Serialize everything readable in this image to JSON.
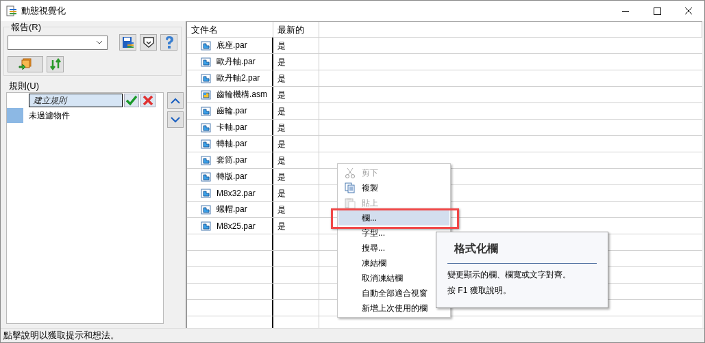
{
  "window": {
    "title": "動態視覺化"
  },
  "report": {
    "label": "報告(R)"
  },
  "rules": {
    "label": "規則(U)",
    "new_rule": {
      "placeholder": "建立規則"
    },
    "items": [
      {
        "label": "未過濾物件",
        "color": "#8cb8e4"
      }
    ]
  },
  "table": {
    "columns": [
      "文件名",
      "最新的"
    ],
    "rows": [
      {
        "kind": "part",
        "name": "底座.par",
        "latest": "是"
      },
      {
        "kind": "part",
        "name": "歐丹軸.par",
        "latest": "是"
      },
      {
        "kind": "part",
        "name": "歐丹軸2.par",
        "latest": "是"
      },
      {
        "kind": "assembly",
        "name": "齒輪機構.asm",
        "latest": "是"
      },
      {
        "kind": "part",
        "name": "齒輪.par",
        "latest": "是"
      },
      {
        "kind": "part",
        "name": "卡軸.par",
        "latest": "是"
      },
      {
        "kind": "part",
        "name": "轉軸.par",
        "latest": "是"
      },
      {
        "kind": "part",
        "name": "套筒.par",
        "latest": "是"
      },
      {
        "kind": "part",
        "name": "轉版.par",
        "latest": "是"
      },
      {
        "kind": "part",
        "name": "M8x32.par",
        "latest": "是"
      },
      {
        "kind": "part",
        "name": "螺帽.par",
        "latest": "是"
      },
      {
        "kind": "part",
        "name": "M8x25.par",
        "latest": "是"
      }
    ]
  },
  "context_menu": [
    {
      "label": "剪下",
      "kind": "cut",
      "disabled": true,
      "selected": false
    },
    {
      "label": "複製",
      "kind": "copy",
      "disabled": false,
      "selected": false
    },
    {
      "label": "貼上",
      "kind": "paste",
      "disabled": true,
      "selected": false
    },
    {
      "label": "欄...",
      "disabled": false,
      "selected": true,
      "outlined": true
    },
    {
      "label": "字型...",
      "disabled": false,
      "selected": false
    },
    {
      "label": "搜尋...",
      "disabled": false,
      "selected": false
    },
    {
      "label": "凍結欄",
      "disabled": false,
      "selected": false
    },
    {
      "label": "取消凍結欄",
      "disabled": false,
      "selected": false
    },
    {
      "label": "自動全部適合視窗",
      "disabled": false,
      "selected": false
    },
    {
      "label": "新增上次使用的欄",
      "disabled": false,
      "selected": false
    }
  ],
  "tooltip": {
    "title": "格式化欄",
    "text": "變更顯示的欄、欄寬或文字對齊。",
    "hint": "按 F1 獲取說明。"
  },
  "status_bar": "點擊說明以獲取提示和想法。"
}
